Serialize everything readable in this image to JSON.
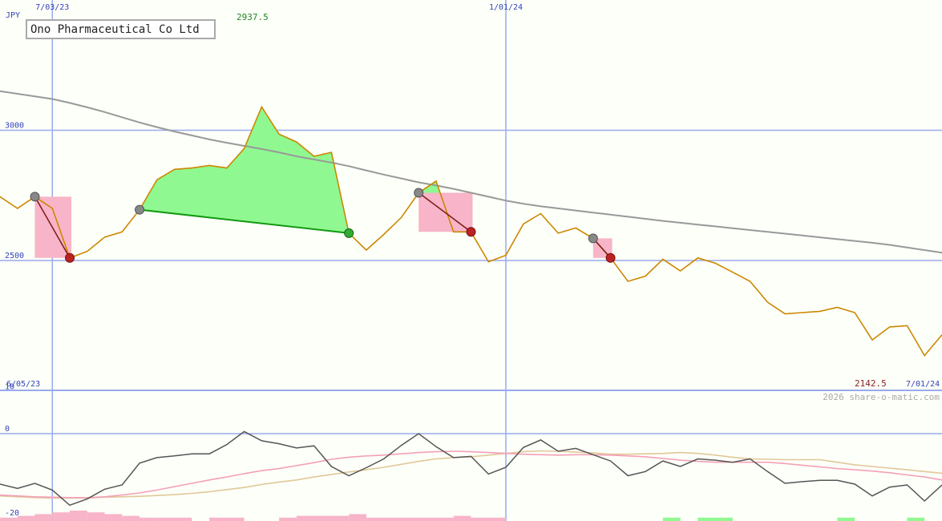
{
  "title": "Ono Pharmaceutical Co Ltd",
  "currency_label": "JPY",
  "high_label": "2937.5",
  "low_label": "2142.5",
  "start_date_label": "6/05/23",
  "end_date_label": "7/01/24",
  "copyright": "2026 share-o-matic.com",
  "colors": {
    "background": "#fdfff9",
    "price": "#cc8800",
    "long_ma": "#999999",
    "grid": "#99aaee",
    "gain_fill": "#90f890",
    "loss_fill": "#f8b4c8",
    "osc": "#555555",
    "osc_pink": "#f4a0b8",
    "osc_tan": "#e0c898"
  },
  "chart_data": [
    {
      "type": "line",
      "panel": "price",
      "ylim": [
        2000,
        3500
      ],
      "yticks": [
        {
          "value": 3000,
          "label": "3000"
        },
        {
          "value": 2500,
          "label": "2500"
        }
      ],
      "xticks": [
        {
          "index": 3,
          "label": "7/03/23"
        },
        {
          "index": 29,
          "label": "1/01/24"
        }
      ],
      "series": [
        {
          "role": "price",
          "values": [
            2745,
            2700,
            2745,
            2700,
            2510,
            2535,
            2590,
            2610,
            2695,
            2810,
            2850,
            2855,
            2865,
            2855,
            2930,
            3090,
            2985,
            2955,
            2900,
            2915,
            2605,
            2540,
            2600,
            2665,
            2760,
            2805,
            2610,
            2610,
            2495,
            2520,
            2640,
            2680,
            2605,
            2625,
            2585,
            2510,
            2420,
            2440,
            2505,
            2460,
            2510,
            2490,
            2455,
            2420,
            2340,
            2295,
            2300,
            2305,
            2320,
            2300,
            2195,
            2245,
            2250,
            2135,
            2215
          ]
        },
        {
          "role": "long_ma",
          "values": [
            3150,
            3140,
            3130,
            3120,
            3105,
            3088,
            3070,
            3050,
            3030,
            3012,
            2995,
            2980,
            2965,
            2952,
            2940,
            2928,
            2915,
            2900,
            2888,
            2876,
            2862,
            2846,
            2830,
            2815,
            2800,
            2788,
            2775,
            2760,
            2745,
            2730,
            2718,
            2708,
            2700,
            2692,
            2684,
            2676,
            2668,
            2660,
            2652,
            2645,
            2638,
            2631,
            2624,
            2617,
            2610,
            2603,
            2596,
            2589,
            2582,
            2575,
            2568,
            2560,
            2550,
            2540,
            2530
          ]
        }
      ],
      "trades": [
        {
          "entry": 2,
          "exit": 4,
          "result": "loss"
        },
        {
          "entry": 8,
          "exit": 20,
          "result": "gain"
        },
        {
          "entry": 24,
          "exit": 27,
          "result": "loss"
        },
        {
          "entry": 34,
          "exit": 35,
          "result": "loss"
        }
      ]
    },
    {
      "type": "line",
      "panel": "oscillator",
      "ylim": [
        -20,
        15
      ],
      "yticks": [
        {
          "value": 10,
          "label": "10"
        },
        {
          "value": 0,
          "label": "0"
        },
        {
          "value": -20,
          "label": "-20"
        }
      ],
      "series": [
        {
          "role": "oscillator",
          "values": [
            -12,
            -13,
            -11.8,
            -13.4,
            -17,
            -15.5,
            -13.2,
            -12.2,
            -7,
            -5.7,
            -5.3,
            -4.8,
            -4.8,
            -2.6,
            0.5,
            -1.7,
            -2.4,
            -3.4,
            -2.9,
            -7.8,
            -10,
            -8.1,
            -6,
            -2.8,
            0,
            -3.1,
            -5.7,
            -5.4,
            -9.6,
            -8,
            -3.3,
            -1.5,
            -4.2,
            -3.5,
            -5,
            -6.5,
            -10,
            -9,
            -6.5,
            -7.8,
            -6,
            -6.3,
            -6.8,
            -6,
            -9,
            -11.8,
            -11.4,
            -11.1,
            -11.1,
            -12,
            -14.8,
            -12.7,
            -12.2,
            -16,
            -12.2
          ]
        },
        {
          "role": "signal_fast",
          "values": [
            -14.6,
            -14.8,
            -15,
            -15.1,
            -15.2,
            -15.2,
            -15.0,
            -14.6,
            -14.1,
            -13.4,
            -12.6,
            -11.8,
            -11.0,
            -10.3,
            -9.5,
            -8.8,
            -8.3,
            -7.6,
            -6.9,
            -6.1,
            -5.6,
            -5.3,
            -5.1,
            -4.8,
            -4.5,
            -4.3,
            -4.2,
            -4.3,
            -4.5,
            -4.7,
            -4.9,
            -5.0,
            -5.1,
            -5.0,
            -5.0,
            -5.1,
            -5.3,
            -5.5,
            -5.9,
            -6.3,
            -6.6,
            -6.8,
            -6.8,
            -6.8,
            -6.8,
            -7.1,
            -7.5,
            -7.9,
            -8.3,
            -8.6,
            -8.9,
            -9.3,
            -9.8,
            -10.3,
            -11.0
          ]
        },
        {
          "role": "signal_slow",
          "values": [
            -14.8,
            -15,
            -15.2,
            -15.3,
            -15.3,
            -15.3,
            -15.1,
            -15.0,
            -14.9,
            -14.7,
            -14.5,
            -14.2,
            -13.8,
            -13.3,
            -12.8,
            -12.1,
            -11.5,
            -11.0,
            -10.3,
            -9.7,
            -9.1,
            -8.6,
            -8.0,
            -7.3,
            -6.6,
            -6.0,
            -5.7,
            -5.5,
            -5.1,
            -4.7,
            -4.3,
            -4.1,
            -4.2,
            -4.4,
            -4.6,
            -4.9,
            -4.9,
            -4.8,
            -4.7,
            -4.5,
            -4.7,
            -5.1,
            -5.6,
            -6.0,
            -6.1,
            -6.2,
            -6.2,
            -6.2,
            -6.8,
            -7.4,
            -7.8,
            -8.2,
            -8.6,
            -9.0,
            -9.4
          ]
        }
      ],
      "histogram": [
        {
          "from": 0,
          "to": 1,
          "value": 1,
          "sign": "neg"
        },
        {
          "from": 1,
          "to": 2,
          "value": 2,
          "sign": "neg"
        },
        {
          "from": 2,
          "to": 3,
          "value": 3,
          "sign": "neg"
        },
        {
          "from": 3,
          "to": 4,
          "value": 4,
          "sign": "neg"
        },
        {
          "from": 4,
          "to": 5,
          "value": 5,
          "sign": "neg"
        },
        {
          "from": 5,
          "to": 6,
          "value": 4,
          "sign": "neg"
        },
        {
          "from": 6,
          "to": 7,
          "value": 3,
          "sign": "neg"
        },
        {
          "from": 7,
          "to": 8,
          "value": 2,
          "sign": "neg"
        },
        {
          "from": 8,
          "to": 9,
          "value": 1,
          "sign": "neg"
        },
        {
          "from": 9,
          "to": 11,
          "value": 1,
          "sign": "neg"
        },
        {
          "from": 12,
          "to": 14,
          "value": 1,
          "sign": "neg"
        },
        {
          "from": 16,
          "to": 17,
          "value": 1,
          "sign": "neg"
        },
        {
          "from": 17,
          "to": 20,
          "value": 2,
          "sign": "neg"
        },
        {
          "from": 20,
          "to": 21,
          "value": 3,
          "sign": "neg"
        },
        {
          "from": 21,
          "to": 26,
          "value": 1,
          "sign": "neg"
        },
        {
          "from": 26,
          "to": 27,
          "value": 2,
          "sign": "neg"
        },
        {
          "from": 27,
          "to": 29,
          "value": 1,
          "sign": "neg"
        },
        {
          "from": 38,
          "to": 39,
          "value": 1,
          "sign": "pos"
        },
        {
          "from": 40,
          "to": 42,
          "value": 1,
          "sign": "pos"
        },
        {
          "from": 48,
          "to": 49,
          "value": 1,
          "sign": "pos"
        },
        {
          "from": 52,
          "to": 53,
          "value": 1,
          "sign": "pos"
        }
      ]
    }
  ]
}
